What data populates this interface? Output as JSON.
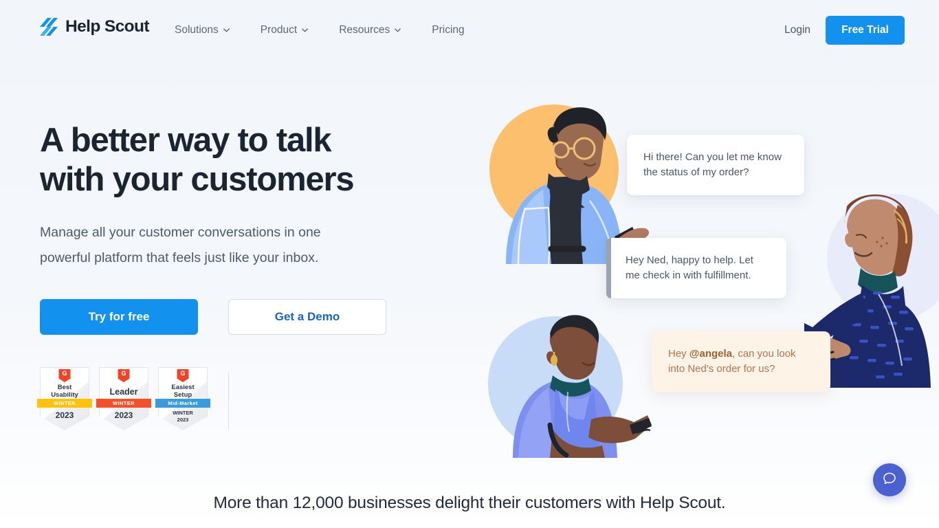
{
  "brand": {
    "name": "Help Scout",
    "logo_icon": "help-scout-logo-icon",
    "primary_color": "#1292ee",
    "text_color": "#1b2532"
  },
  "header": {
    "nav": [
      {
        "label": "Solutions",
        "has_dropdown": true,
        "icon": "chevron-down-icon"
      },
      {
        "label": "Product",
        "has_dropdown": true,
        "icon": "chevron-down-icon"
      },
      {
        "label": "Resources",
        "has_dropdown": true,
        "icon": "chevron-down-icon"
      },
      {
        "label": "Pricing",
        "has_dropdown": false,
        "icon": ""
      }
    ],
    "login_label": "Login",
    "trial_label": "Free Trial"
  },
  "hero": {
    "headline_line1": "A better way to talk",
    "headline_line2": "with your customers",
    "subhead": "Manage all your customer conversations in one powerful platform that feels just like your inbox.",
    "cta_primary": "Try for free",
    "cta_secondary": "Get a Demo"
  },
  "badges": [
    {
      "source": "G2",
      "title_line1": "Best",
      "title_line2": "Usability",
      "ribbon": "WINTER",
      "ribbon_color": "#ffc20e",
      "year": "2023",
      "sub_year": ""
    },
    {
      "source": "G2",
      "title_line1": "Leader",
      "title_line2": "",
      "ribbon": "WINTER",
      "ribbon_color": "#f4502c",
      "year": "2023",
      "sub_year": ""
    },
    {
      "source": "G2",
      "title_line1": "Easiest",
      "title_line2": "Setup",
      "ribbon": "Mid-Market",
      "ribbon_color": "#3a9bdc",
      "year": "WINTER",
      "sub_year": "2023"
    }
  ],
  "conversation": {
    "messages": [
      {
        "id": "customer-question",
        "text": "Hi there! Can you let me know the status of my order?",
        "style": "white"
      },
      {
        "id": "agent-reply",
        "text": "Hey Ned, happy to help. Let me check in with fulfillment.",
        "style": "white-with-bar"
      },
      {
        "id": "internal-note",
        "text_before": "Hey ",
        "mention": "@angela",
        "text_after": ", can you look into Ned's order for us?",
        "style": "note"
      }
    ]
  },
  "illustrations": [
    {
      "name": "agent-with-glasses",
      "circle_color": "#fbbf6d"
    },
    {
      "name": "customer-listening",
      "circle_color": "#c9dcf7"
    },
    {
      "name": "teammate-angela",
      "circle_color": "#e7ebfa"
    }
  ],
  "footer_tagline": "More than 12,000 businesses delight their customers with Help Scout.",
  "chat_widget": {
    "icon": "chat-bubble-icon",
    "color": "#4b61d1"
  }
}
